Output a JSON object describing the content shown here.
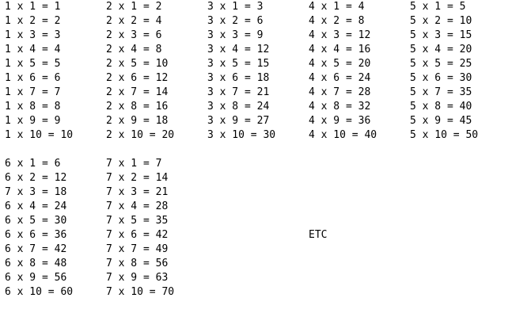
{
  "tables": [
    {
      "lines": [
        "1 x 1 = 1",
        "1 x 2 = 2",
        "1 x 3 = 3",
        "1 x 4 = 4",
        "1 x 5 = 5",
        "1 x 6 = 6",
        "1 x 7 = 7",
        "1 x 8 = 8",
        "1 x 9 = 9",
        "1 x 10 = 10"
      ]
    },
    {
      "lines": [
        "2 x 1 = 2",
        "2 x 2 = 4",
        "2 x 3 = 6",
        "2 x 4 = 8",
        "2 x 5 = 10",
        "2 x 6 = 12",
        "2 x 7 = 14",
        "2 x 8 = 16",
        "2 x 9 = 18",
        "2 x 10 = 20"
      ]
    },
    {
      "lines": [
        "3 x 1 = 3",
        "3 x 2 = 6",
        "3 x 3 = 9",
        "3 x 4 = 12",
        "3 x 5 = 15",
        "3 x 6 = 18",
        "3 x 7 = 21",
        "3 x 8 = 24",
        "3 x 9 = 27",
        "3 x 10 = 30"
      ]
    },
    {
      "lines": [
        "4 x 1 = 4",
        "4 x 2 = 8",
        "4 x 3 = 12",
        "4 x 4 = 16",
        "4 x 5 = 20",
        "4 x 6 = 24",
        "4 x 7 = 28",
        "4 x 8 = 32",
        "4 x 9 = 36",
        "4 x 10 = 40"
      ]
    },
    {
      "lines": [
        "5 x 1 = 5",
        "5 x 2 = 10",
        "5 x 3 = 15",
        "5 x 4 = 20",
        "5 x 5 = 25",
        "5 x 6 = 30",
        "5 x 7 = 35",
        "5 x 8 = 40",
        "5 x 9 = 45",
        "5 x 10 = 50"
      ]
    },
    {
      "lines": [
        "6 x 1 = 6",
        "6 x 2 = 12",
        "7 x 3 = 18",
        "6 x 4 = 24",
        "6 x 5 = 30",
        "6 x 6 = 36",
        "6 x 7 = 42",
        "6 x 8 = 48",
        "6 x 9 = 56",
        "6 x 10 = 60"
      ]
    },
    {
      "lines": [
        "7 x 1 = 7",
        "7 x 2 = 14",
        "7 x 3 = 21",
        "7 x 4 = 28",
        "7 x 5 = 35",
        "7 x 6 = 42",
        "7 x 7 = 49",
        "7 x 8 = 56",
        "7 x 9 = 63",
        "7 x 10 = 70"
      ]
    }
  ],
  "etc_label": "ETC"
}
